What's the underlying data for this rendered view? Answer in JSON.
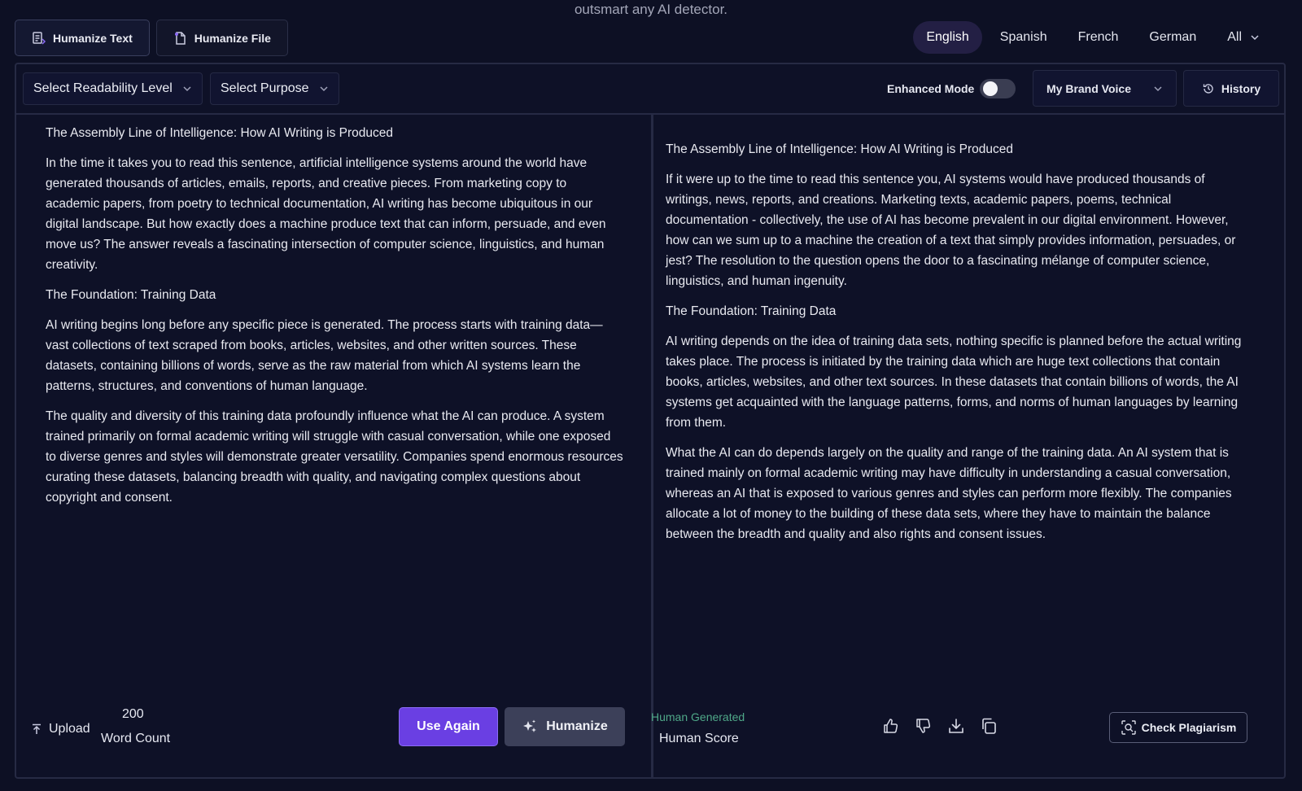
{
  "tagline": "outsmart any AI detector.",
  "mode_tabs": [
    {
      "label": "Humanize Text",
      "icon": "text-doc-icon"
    },
    {
      "label": "Humanize File",
      "icon": "file-icon"
    }
  ],
  "languages": {
    "items": [
      "English",
      "Spanish",
      "French",
      "German"
    ],
    "active": "English",
    "more_label": "All"
  },
  "toolbar": {
    "readability_label": "Select Readability Level",
    "purpose_label": "Select Purpose",
    "enhanced_label": "Enhanced Mode",
    "enhanced_on": false,
    "brand_voice_label": "My Brand Voice",
    "history_label": "History"
  },
  "input": {
    "paragraphs": [
      "The Assembly Line of Intelligence: How AI Writing is Produced",
      "In the time it takes you to read this sentence, artificial intelligence systems around the world have generated thousands of articles, emails, reports, and creative pieces. From marketing copy to academic papers, from poetry to technical documentation, AI writing has become ubiquitous in our digital landscape. But how exactly does a machine produce text that can inform, persuade, and even move us? The answer reveals a fascinating intersection of computer science, linguistics, and human creativity.",
      "The Foundation: Training Data",
      "AI writing begins long before any specific piece is generated. The process starts with training data—vast collections of text scraped from books, articles, websites, and other written sources. These datasets, containing billions of words, serve as the raw material from which AI systems learn the patterns, structures, and conventions of human language.",
      "The quality and diversity of this training data profoundly influence what the AI can produce. A system trained primarily on formal academic writing will struggle with casual conversation, while one exposed to diverse genres and styles will demonstrate greater versatility. Companies spend enormous resources curating these datasets, balancing breadth with quality, and navigating complex questions about copyright and consent."
    ],
    "upload_label": "Upload",
    "word_count": "200",
    "word_count_label": "Word Count",
    "use_again_label": "Use Again",
    "humanize_label": "Humanize"
  },
  "output": {
    "paragraphs": [
      "The Assembly Line of Intelligence: How AI Writing is Produced",
      "If it were up to the time to read this sentence you, AI systems would have produced thousands of writings, news, reports, and creations. Marketing texts, academic papers, poems, technical documentation - collectively, the use of AI has become prevalent in our digital environment. However, how can we sum up to a machine the creation of a text that simply provides information, persuades, or jest? The resolution to the question opens the door to a fascinating mélange of computer science, linguistics, and human ingenuity.",
      "The Foundation: Training Data",
      "AI writing depends on the idea of training data sets, nothing specific is planned before the actual writing takes place. The process is initiated by the training data which are huge text collections that contain books, articles, websites, and other text sources. In these datasets that contain billions of words, the AI systems get acquainted with the language patterns, forms, and norms of human languages by learning from them.",
      "What the AI can do depends largely on the quality and range of the training data. An AI system that is trained mainly on formal academic writing may have difficulty in understanding a casual conversation, whereas an AI that is exposed to various genres and styles can perform more flexibly. The companies allocate a lot of money to the building of these data sets, where they have to maintain the balance between the breadth and quality and also rights and consent issues."
    ],
    "status_label": "Human Generated",
    "status_color": "#4fa888",
    "score_label": "Human Score",
    "plagiarism_label": "Check Plagiarism"
  },
  "colors": {
    "background": "#0d1024",
    "accent": "#6a3fe3",
    "border": "#262a44"
  }
}
